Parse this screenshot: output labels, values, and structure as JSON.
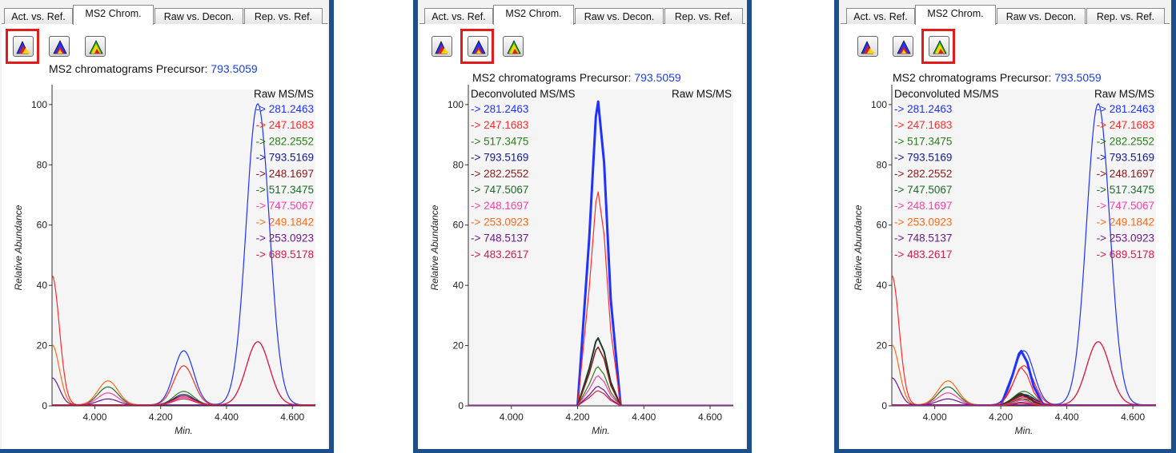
{
  "tabs": [
    "Act. vs. Ref.",
    "MS2 Chrom.",
    "Raw vs. Decon.",
    "Rep. vs. Ref."
  ],
  "title_label": "MS2 chromatograms Precursor:",
  "precursor": "793.5059",
  "raw_label": "Raw MS/MS",
  "decon_label": "Deconvoluted MS/MS",
  "raw_list": [
    {
      "label": "-> 281.2463",
      "color": "#1f32ff"
    },
    {
      "label": "-> 247.1683",
      "color": "#ff2b2b"
    },
    {
      "label": "-> 282.2552",
      "color": "#2b7d1a"
    },
    {
      "label": "-> 793.5169",
      "color": "#141a8a"
    },
    {
      "label": "-> 248.1697",
      "color": "#8a1a1a"
    },
    {
      "label": "-> 517.3475",
      "color": "#1e6b2a"
    },
    {
      "label": "-> 747.5067",
      "color": "#ff3fa8"
    },
    {
      "label": "-> 249.1842",
      "color": "#ff6a1a"
    },
    {
      "label": "-> 253.0923",
      "color": "#6b1a8a"
    },
    {
      "label": "-> 689.5178",
      "color": "#d81a4a"
    }
  ],
  "decon_list": [
    {
      "label": "-> 281.2463",
      "color": "#1f32ff"
    },
    {
      "label": "-> 247.1683",
      "color": "#ff2b2b"
    },
    {
      "label": "-> 517.3475",
      "color": "#2b7d1a"
    },
    {
      "label": "-> 793.5169",
      "color": "#141a8a"
    },
    {
      "label": "-> 282.2552",
      "color": "#8a1a1a"
    },
    {
      "label": "-> 747.5067",
      "color": "#1e6b2a"
    },
    {
      "label": "-> 248.1697",
      "color": "#ff3fa8"
    },
    {
      "label": "-> 253.0923",
      "color": "#ff6a1a"
    },
    {
      "label": "-> 748.5137",
      "color": "#6b1a8a"
    },
    {
      "label": "-> 483.2617",
      "color": "#d81a4a"
    }
  ],
  "chart_data": [
    {
      "type": "line",
      "mode": "raw",
      "xlabel": "Min.",
      "ylabel": "Relative Abundance",
      "xlim": [
        3.87,
        4.67
      ],
      "ylim": [
        0,
        105
      ],
      "xticks": [
        "4.000",
        "4.200",
        "4.400",
        "4.600"
      ],
      "yticks": [
        "0",
        "20",
        "40",
        "60",
        "80",
        "100"
      ],
      "selected_button": 0
    },
    {
      "type": "line",
      "mode": "decon",
      "xlabel": "Min.",
      "ylabel": "Relative Abundance",
      "xlim": [
        3.87,
        4.67
      ],
      "ylim": [
        0,
        105
      ],
      "xticks": [
        "4.000",
        "4.200",
        "4.400",
        "4.600"
      ],
      "yticks": [
        "0",
        "20",
        "40",
        "60",
        "80",
        "100"
      ],
      "selected_button": 1
    },
    {
      "type": "line",
      "mode": "both",
      "xlabel": "Min.",
      "ylabel": "Relative Abundance",
      "xlim": [
        3.87,
        4.67
      ],
      "ylim": [
        0,
        105
      ],
      "xticks": [
        "4.000",
        "4.200",
        "4.400",
        "4.600"
      ],
      "yticks": [
        "0",
        "20",
        "40",
        "60",
        "80",
        "100"
      ],
      "selected_button": 2
    }
  ],
  "raw_peaks": [
    {
      "color": "#1f32ff",
      "peaks": [
        [
          4.27,
          18
        ],
        [
          4.495,
          100
        ]
      ]
    },
    {
      "color": "#ff2b2b",
      "peaks": [
        [
          3.87,
          43
        ],
        [
          4.27,
          13
        ],
        [
          4.495,
          21
        ]
      ]
    },
    {
      "color": "#2b7d1a",
      "peaks": [
        [
          4.27,
          4.5
        ]
      ]
    },
    {
      "color": "#141a8a",
      "peaks": [
        [
          4.27,
          3.5
        ]
      ]
    },
    {
      "color": "#8a1a1a",
      "peaks": [
        [
          4.27,
          3
        ]
      ]
    },
    {
      "color": "#1e6b2a",
      "peaks": [
        [
          4.04,
          6
        ]
      ]
    },
    {
      "color": "#ff3fa8",
      "peaks": [
        [
          4.04,
          4
        ],
        [
          4.27,
          2.5
        ]
      ]
    },
    {
      "color": "#ff6a1a",
      "peaks": [
        [
          3.87,
          20
        ],
        [
          4.04,
          8
        ]
      ]
    },
    {
      "color": "#6b1a8a",
      "peaks": [
        [
          3.87,
          9
        ],
        [
          4.04,
          2
        ]
      ]
    },
    {
      "color": "#d81a4a",
      "peaks": [
        [
          4.27,
          2
        ],
        [
          4.495,
          21
        ]
      ]
    }
  ],
  "decon_peaks": [
    {
      "color": "#1f32ff",
      "value": 101,
      "width": 3
    },
    {
      "color": "#ff2b2b",
      "value": 71,
      "width": 1.2
    },
    {
      "color": "#1a3a2a",
      "value": 22.5,
      "width": 2
    },
    {
      "color": "#8a1a1a",
      "value": 19.5,
      "width": 1.5
    },
    {
      "color": "#2b7d1a",
      "value": 13,
      "width": 1.2
    },
    {
      "color": "#ff3fa8",
      "value": 10,
      "width": 1.2
    },
    {
      "color": "#6b1a8a",
      "value": 6.5,
      "width": 1.2
    },
    {
      "color": "#d81a4a",
      "value": 5,
      "width": 1.2
    }
  ]
}
